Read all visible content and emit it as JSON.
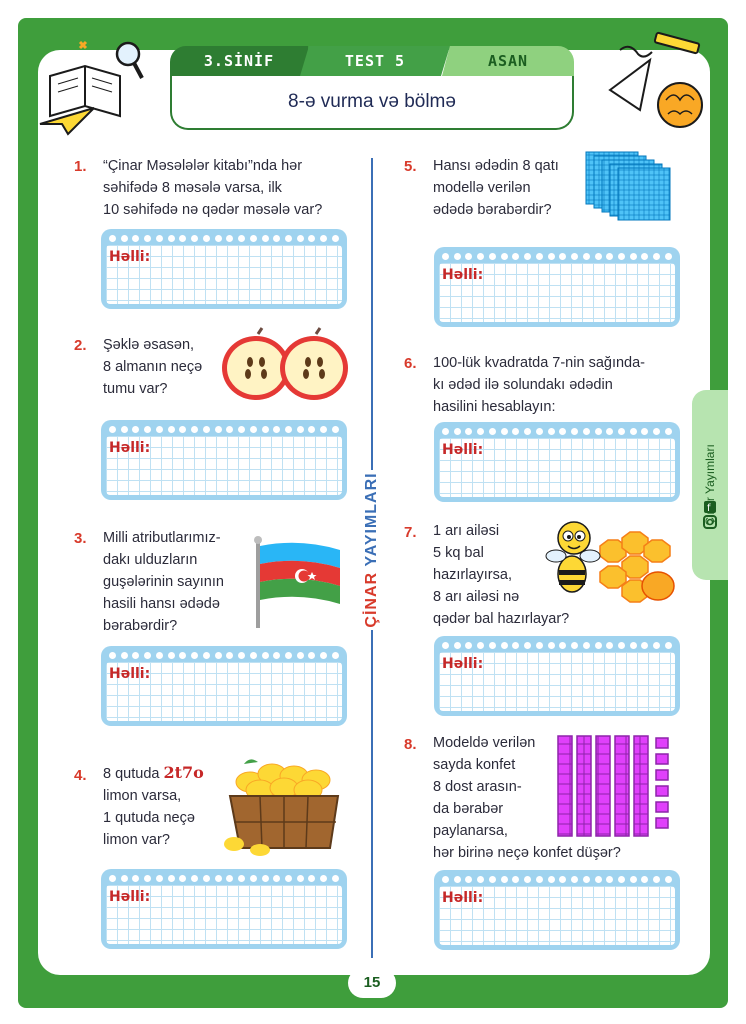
{
  "header": {
    "grade": "3.SİNİF",
    "test": "TEST 5",
    "level": "ASAN",
    "title": "8-ə vurma və bölmə"
  },
  "brand": {
    "part1": "ÇİNAR",
    "part2": "YAYIMLARI"
  },
  "side_tab": {
    "label": "Çinar Yayımları"
  },
  "answer_label": "Həlli:",
  "questions": [
    {
      "num": "1.",
      "lines": [
        "“Çinar Məsələlər kitabı”nda hər",
        "səhifədə 8 məsələ varsa, ilk",
        "10 səhifədə nə qədər məsələ var?"
      ]
    },
    {
      "num": "2.",
      "lines": [
        "Şəklə əsasən,",
        "8 almanın neçə",
        "tumu var?"
      ]
    },
    {
      "num": "3.",
      "lines": [
        "Milli atributlarımız-",
        "dakı ulduzların",
        "guşələrinin sayının",
        "hasili hansı ədədə",
        "bərabərdir?"
      ]
    },
    {
      "num": "4.",
      "line1_pre": "8 qutuda ",
      "line1_value": "2t7o",
      "lines": [
        "limon varsa,",
        "1 qutuda neçə",
        "limon var?"
      ]
    },
    {
      "num": "5.",
      "lines": [
        "Hansı ədədin 8 qatı",
        "modellə verilən",
        "ədədə bərabərdir?"
      ]
    },
    {
      "num": "6.",
      "lines": [
        "100-lük kvadratda 7-nin sağında-",
        "kı ədəd ilə solundakı ədədin",
        "hasilini hesablayın:"
      ]
    },
    {
      "num": "7.",
      "lines": [
        "1 arı ailəsi",
        "5 kq bal",
        "hazırlayırsa,",
        "8 arı ailəsi nə",
        "qədər bal hazırlayar?"
      ]
    },
    {
      "num": "8.",
      "lines": [
        "Modeldə verilən",
        "sayda konfet",
        "8 dost arasın-",
        "da bərabər",
        "paylanarsa,",
        "hər birinə neçə konfet düşər?"
      ]
    }
  ],
  "page_number": "15",
  "colors": {
    "frame": "#3f9e3c",
    "accent_red": "#d83a2b",
    "divider_blue": "#3b6fb6",
    "answer_box": "#9fd3ef"
  }
}
